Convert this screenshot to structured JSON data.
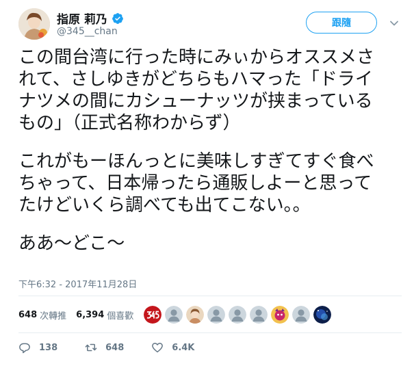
{
  "user": {
    "display_name": "指原 莉乃",
    "handle": "@345__chan",
    "verified": true
  },
  "follow_button": {
    "label": "跟隨"
  },
  "tweet": {
    "paragraphs": [
      [
        "この間台湾に行った時にみぃからオススメさ",
        "れて、さしゆきがどちらもハマった「ドライ",
        "ナツメの間にカシューナッツが挟まっている",
        "もの」（正式名称わからず）"
      ],
      [
        "これがもーほんっとに美味しすぎてすぐ食べ",
        "ちゃって、日本帰ったら通販しよーと思って",
        "たけどいくら調べても出てこない。。"
      ],
      [
        "ああ〜どこ〜"
      ]
    ],
    "timestamp": "下午6:32 - 2017年11月28日"
  },
  "stats": {
    "retweets": {
      "count": "648",
      "label": "次轉推"
    },
    "likes": {
      "count": "6,394",
      "label": "個喜歡"
    }
  },
  "likers": [
    {
      "name": "avatar-345-logo",
      "color": "#c4161c"
    },
    {
      "name": "avatar-default",
      "color": "#a9b4bd"
    },
    {
      "name": "avatar-photo-girl",
      "color": "#d9b48f"
    },
    {
      "name": "avatar-default",
      "color": "#a9b4bd"
    },
    {
      "name": "avatar-default",
      "color": "#a9b4bd"
    },
    {
      "name": "avatar-default",
      "color": "#a9b4bd"
    },
    {
      "name": "avatar-illustration",
      "color": "#c8266b"
    },
    {
      "name": "avatar-default",
      "color": "#a9b4bd"
    },
    {
      "name": "avatar-blue-space",
      "color": "#1f3f8a"
    }
  ],
  "actions": {
    "reply": {
      "icon": "reply-icon",
      "count": "138"
    },
    "retweet": {
      "icon": "retweet-icon",
      "count": "648"
    },
    "like": {
      "icon": "heart-icon",
      "count": "6.4K"
    }
  },
  "colors": {
    "accent": "#1da1f2",
    "text": "#14171a",
    "muted": "#657786",
    "divider": "#e6ecf0"
  }
}
